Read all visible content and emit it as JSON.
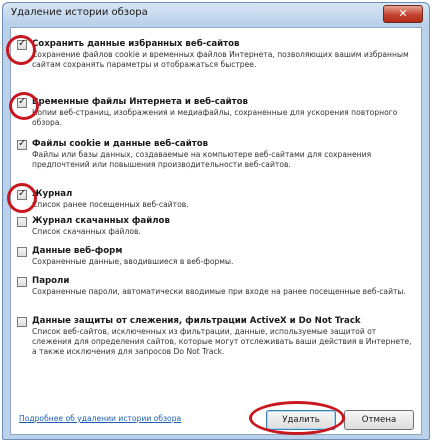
{
  "dialog": {
    "title": "Удаление истории обзора",
    "close_label": "✕"
  },
  "options": [
    {
      "title": "Сохранить данные избранных веб-сайтов",
      "description": "Сохранение файлов cookie и временных файлов Интернета, позволяющих вашим избранным сайтам сохранять параметры и отображаться быстрее.",
      "checked": true
    },
    {
      "title": "Временные файлы Интернета и веб-сайтов",
      "description": "Копии веб-страниц, изображения и медиафайлы, сохраненные для ускорения повторного обзора.",
      "checked": true
    },
    {
      "title": "Файлы cookie и данные веб-сайтов",
      "description": "Файлы или базы данных, создаваемые на компьютере веб-сайтами для сохранения предпочтений или повышения производительности веб-сайтов.",
      "checked": true
    },
    {
      "title": "Журнал",
      "description": "Список ранее посещенных веб-сайтов.",
      "checked": true
    },
    {
      "title": "Журнал скачанных файлов",
      "description": "Список скачанных файлов.",
      "checked": false
    },
    {
      "title": "Данные веб-форм",
      "description": "Сохраненные данные, вводившиеся в веб-формы.",
      "checked": false
    },
    {
      "title": "Пароли",
      "description": "Сохраненные пароли, автоматически вводимые при входе на ранее посещенные веб-сайты.",
      "checked": false
    },
    {
      "title": "Данные защиты от слежения, фильтрации ActiveX и Do Not Track",
      "description": "Список веб-сайтов, исключенных из фильтрации, данные, используемые защитой от слежения для определения сайтов, которые могут отслеживать ваши действия в Интернете, а также исключения для запросов Do Not Track.",
      "checked": false
    }
  ],
  "footer": {
    "link_text": "Подробнее об удалении истории обзора",
    "delete_label": "Удалить",
    "cancel_label": "Отмена"
  },
  "annotation_color": "#c8171e"
}
